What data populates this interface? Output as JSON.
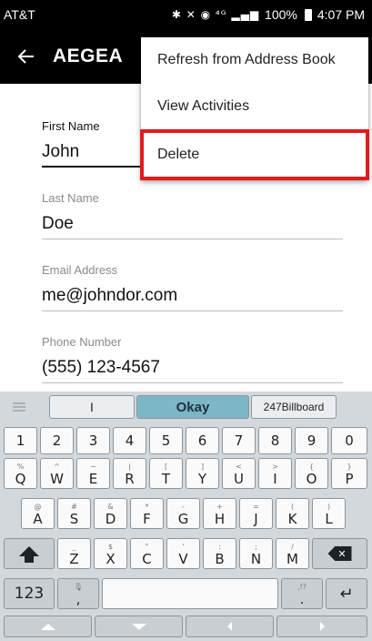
{
  "status_bar": {
    "carrier": "AT&T",
    "icons": "✱ ✕ ◉ ⁴ᴳ ▂▄▆",
    "battery": "100%",
    "time": "4:07 PM"
  },
  "app_bar": {
    "back_icon": "arrow-left-icon",
    "title": "AEGEA"
  },
  "form": {
    "first_name": {
      "label": "First Name",
      "value": "John"
    },
    "last_name": {
      "label": "Last Name",
      "value": "Doe"
    },
    "email": {
      "label": "Email Address",
      "value": "me@johndor.com"
    },
    "phone": {
      "label": "Phone Number",
      "value": "(555) 123-4567"
    }
  },
  "menu": {
    "items": [
      {
        "label": "Refresh from Address Book"
      },
      {
        "label": "View Activities"
      },
      {
        "label": "Delete"
      }
    ],
    "highlight_color": "#e31b1b"
  },
  "keyboard": {
    "suggestions": [
      "I",
      "Okay",
      "247Billboard"
    ],
    "number_row": [
      "1",
      "2",
      "3",
      "4",
      "5",
      "6",
      "7",
      "8",
      "9",
      "0"
    ],
    "row1": [
      {
        "hint": "%",
        "key": "Q"
      },
      {
        "hint": "^",
        "key": "W"
      },
      {
        "hint": "~",
        "key": "E"
      },
      {
        "hint": "|",
        "key": "R"
      },
      {
        "hint": "[",
        "key": "T"
      },
      {
        "hint": "]",
        "key": "Y"
      },
      {
        "hint": "<",
        "key": "U"
      },
      {
        "hint": ">",
        "key": "I"
      },
      {
        "hint": "{",
        "key": "O"
      },
      {
        "hint": "}",
        "key": "P"
      }
    ],
    "row2": [
      {
        "hint": "@",
        "key": "A"
      },
      {
        "hint": "#",
        "key": "S"
      },
      {
        "hint": "&",
        "key": "D"
      },
      {
        "hint": "*",
        "key": "F"
      },
      {
        "hint": "-",
        "key": "G"
      },
      {
        "hint": "+",
        "key": "H"
      },
      {
        "hint": "=",
        "key": "J"
      },
      {
        "hint": "(",
        "key": "K"
      },
      {
        "hint": ")",
        "key": "L"
      }
    ],
    "row3": [
      {
        "hint": "_",
        "key": "Z"
      },
      {
        "hint": "$",
        "key": "X"
      },
      {
        "hint": "\"",
        "key": "C"
      },
      {
        "hint": "'",
        "key": "V"
      },
      {
        "hint": ":",
        "key": "B"
      },
      {
        "hint": ";",
        "key": "N"
      },
      {
        "hint": "/",
        "key": "M"
      }
    ],
    "symbols_key": "123",
    "comma_key": ",",
    "mic_hint": "🎙",
    "period_key": ".",
    "period_hint": ",!?",
    "accent_color": "#7db6c6"
  }
}
